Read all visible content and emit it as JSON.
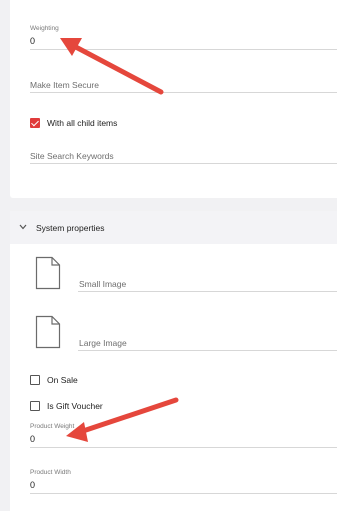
{
  "general": {
    "weighting_label": "Weighting",
    "weighting_value": "0",
    "make_item_secure_label": "Make Item Secure",
    "with_all_child_items_label": "With all child items",
    "with_all_child_items_checked": true,
    "site_search_keywords_label": "Site Search Keywords"
  },
  "system_properties": {
    "title": "System properties",
    "small_image_label": "Small Image",
    "large_image_label": "Large Image",
    "on_sale_label": "On Sale",
    "on_sale_checked": false,
    "is_gift_voucher_label": "Is Gift Voucher",
    "is_gift_voucher_checked": false,
    "product_weight_label": "Product Weight",
    "product_weight_value": "0",
    "product_width_label": "Product Width",
    "product_width_value": "0"
  },
  "annotation": {
    "arrow_color": "#e5473c"
  }
}
